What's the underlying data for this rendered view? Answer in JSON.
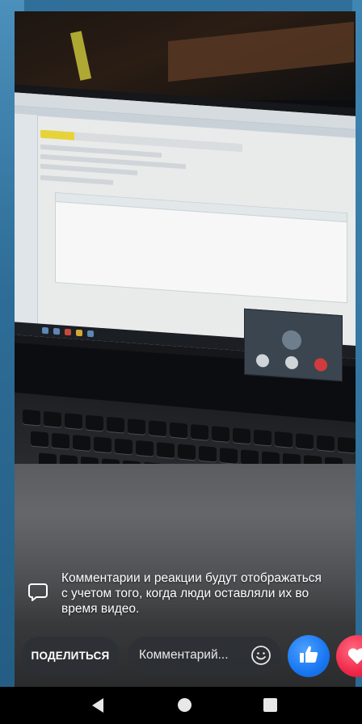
{
  "overlay": {
    "notice_text": "Комментарии и реакции будут отображаться с учетом того, когда люди оставляли их во время видео."
  },
  "actions": {
    "share_label": "ПОДЕЛИТЬСЯ",
    "comment_placeholder": "Комментарий..."
  },
  "reactions": [
    "like",
    "love"
  ],
  "icons": {
    "notice": "speech-bubble-icon",
    "emoji": "smiley-icon",
    "like": "thumbs-up-icon",
    "love": "heart-icon",
    "back": "back-triangle-icon",
    "home": "home-circle-icon",
    "recent": "recent-apps-square-icon"
  },
  "colors": {
    "like_blue": "#1877f2",
    "love_red": "#f0284a",
    "pill_bg": "#2d3034",
    "wallpaper": "#2f6f99"
  }
}
